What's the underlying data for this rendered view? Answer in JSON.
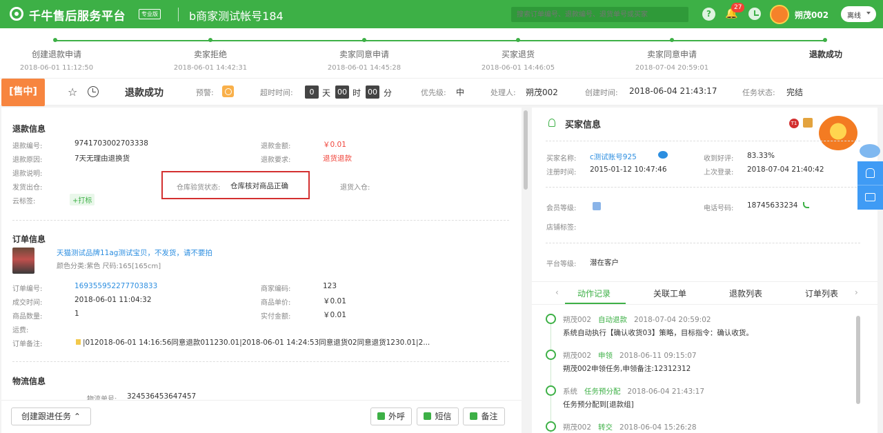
{
  "topbar": {
    "brand": "千牛售后服务平台",
    "edition": "专业版",
    "account": "b商家测试帐号184",
    "search_placeholder": "搜索订单编号、退款编号、退货单号或买家",
    "notification_count": "27",
    "user_name": "朔茂002",
    "status": "离线",
    "icons": [
      "help-icon",
      "bell-icon",
      "clock-icon"
    ]
  },
  "progress": {
    "steps": [
      {
        "label": "创建退款申请",
        "time": "2018-06-01 11:12:50"
      },
      {
        "label": "卖家拒绝",
        "time": "2018-06-01 14:42:31"
      },
      {
        "label": "卖家同意申请",
        "time": "2018-06-01 14:45:28"
      },
      {
        "label": "买家退货",
        "time": "2018-06-01 14:46:05"
      },
      {
        "label": "卖家同意申请",
        "time": "2018-07-04 20:59:01"
      },
      {
        "label": "退款成功",
        "time": ""
      }
    ]
  },
  "task": {
    "tag": "[售中]",
    "title": "退款成功",
    "warning_label": "预警:",
    "timeout_label": "超时时间:",
    "timeout_days": "0",
    "unit_day": "天",
    "timeout_hours": "00",
    "unit_hour": "时",
    "timeout_minutes": "00",
    "unit_minute": "分",
    "priority_label": "优先级:",
    "priority": "中",
    "handler_label": "处理人:",
    "handler": "朔茂002",
    "created_label": "创建时间:",
    "created": "2018-06-04 21:43:17",
    "status_label": "任务状态:",
    "status": "完结"
  },
  "refund": {
    "title": "退款信息",
    "no_label": "退款编号:",
    "no": "9741703002703338",
    "amount_label": "退款金额:",
    "amount": "￥0.01",
    "reason_label": "退款原因:",
    "reason": "7天无理由退换货",
    "requirement_label": "退款要求:",
    "requirement": "退货退款",
    "desc_label": "退款说明:",
    "warehouse_label": "发货出仓:",
    "inspect_label": "仓库验货状态:",
    "inspect": "仓库核对商品正确",
    "return_label": "退货入仓:",
    "cloud_label": "云标签:",
    "cloud_action": "+打标"
  },
  "order": {
    "title": "订单信息",
    "product_name": "天猫测试品牌11ag测试宝贝，不发货，请不要拍",
    "product_spec": "颜色分类:紫色 尺码:165[165cm]",
    "no_label": "订单编号:",
    "no": "169355952277703833",
    "merchant_code_label": "商家编码:",
    "merchant_code": "123",
    "deal_time_label": "成交时间:",
    "deal_time": "2018-06-01 11:04:32",
    "unit_price_label": "商品单价:",
    "unit_price": "￥0.01",
    "qty_label": "商品数量:",
    "qty": "1",
    "paid_label": "实付金额:",
    "paid": "￥0.01",
    "shipping_label": "运费:",
    "remark_label": "订单备注:",
    "remark": "|012018-06-01 14:16:56同意退款011230.01|2018-06-01 14:24:53同意退货02同意退货1230.01|2..."
  },
  "logistics": {
    "title": "物流信息",
    "no_label": "物流单号:",
    "no": "324536453647457"
  },
  "bottom": {
    "follow_task": "创建跟进任务",
    "call": "外呼",
    "sms": "短信",
    "note": "备注"
  },
  "buyer": {
    "title": "买家信息",
    "level_badge": "T1",
    "name_label": "买家名称:",
    "name": "c测试账号925",
    "rating_label": "收到好评:",
    "rating": "83.33%",
    "register_label": "注册时间:",
    "register": "2015-01-12 10:47:46",
    "last_login_label": "上次登录:",
    "last_login": "2018-07-04 21:40:42",
    "member_label": "会员等级:",
    "phone_label": "电话号码:",
    "phone": "18745633234",
    "shop_tag_label": "店铺标签:",
    "platform_label": "平台等级:",
    "platform": "潜在客户"
  },
  "tabs": [
    "动作记录",
    "关联工单",
    "退款列表",
    "订单列表"
  ],
  "timeline": [
    {
      "user": "朔茂002",
      "action": "自动退款",
      "time": "2018-07-04 20:59:02",
      "body": "系统自动执行【确认收货03】策略，目标指令：确认收货。"
    },
    {
      "user": "朔茂002",
      "action": "申领",
      "time": "2018-06-11 09:15:07",
      "body": "朔茂002申领任务,申领备注:12312312"
    },
    {
      "user": "系统",
      "action": "任务预分配",
      "time": "2018-06-04 21:43:17",
      "body": "任务预分配到[退款组]"
    },
    {
      "user": "朔茂002",
      "action": "转交",
      "time": "2018-06-04 15:26:28",
      "body": ""
    }
  ],
  "colors": {
    "brand_green": "#3db046",
    "sale_tag": "#f7853f",
    "link": "#2c8ee0",
    "red": "#f0463c",
    "float_blue": "#3f9bf5"
  }
}
